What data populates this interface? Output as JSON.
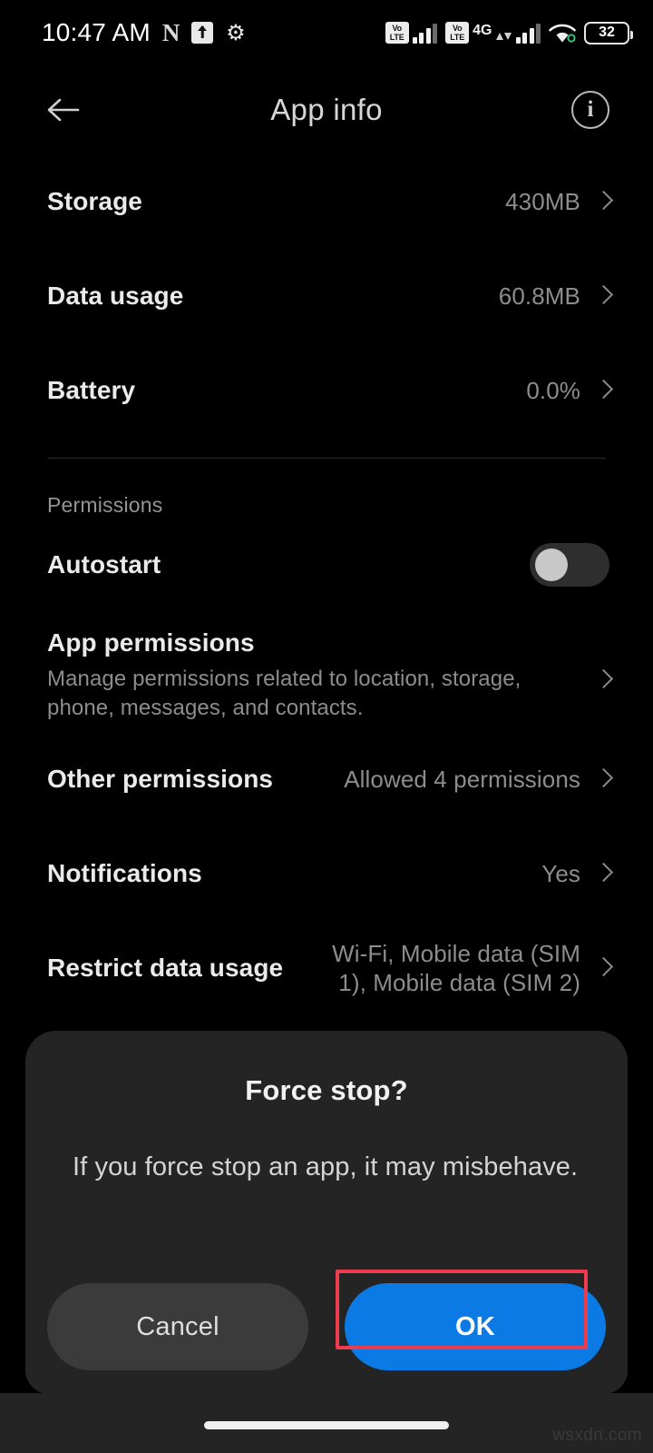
{
  "status_bar": {
    "time": "10:47 AM",
    "left_icons": [
      {
        "name": "netflix-icon",
        "glyph": "N"
      },
      {
        "name": "upload-arrow-icon",
        "glyph": "↑"
      },
      {
        "name": "gear-icon",
        "glyph": "⚙"
      }
    ],
    "sim1": {
      "volte_label_top": "Vo",
      "volte_label_bottom": "LTE",
      "signal_bars": 4
    },
    "sim2": {
      "volte_label_top": "Vo",
      "volte_label_bottom": "LTE",
      "network": "4G",
      "signal_bars": 4
    },
    "wifi": "wifi-icon",
    "battery_percent": "32"
  },
  "app_bar": {
    "back": "back-arrow",
    "title": "App info",
    "info": "i"
  },
  "usage_rows": [
    {
      "title": "Storage",
      "value": "430MB"
    },
    {
      "title": "Data usage",
      "value": "60.8MB"
    },
    {
      "title": "Battery",
      "value": "0.0%"
    }
  ],
  "permissions": {
    "section_label": "Permissions",
    "autostart": {
      "title": "Autostart",
      "enabled": false
    },
    "app_permissions": {
      "title": "App permissions",
      "description": "Manage permissions related to location, storage, phone, messages, and contacts."
    },
    "other_permissions": {
      "title": "Other permissions",
      "value": "Allowed 4 permissions"
    },
    "notifications": {
      "title": "Notifications",
      "value": "Yes"
    },
    "restrict_data_usage": {
      "title": "Restrict data usage",
      "value": "Wi-Fi, Mobile data (SIM 1), Mobile data (SIM 2)"
    }
  },
  "dialog": {
    "title": "Force stop?",
    "body": "If you force stop an app, it may misbehave.",
    "cancel_label": "Cancel",
    "ok_label": "OK",
    "ok_color": "#0c7ae5",
    "highlight_color": "#ef3b4e"
  },
  "watermark": "wsxdn.com"
}
